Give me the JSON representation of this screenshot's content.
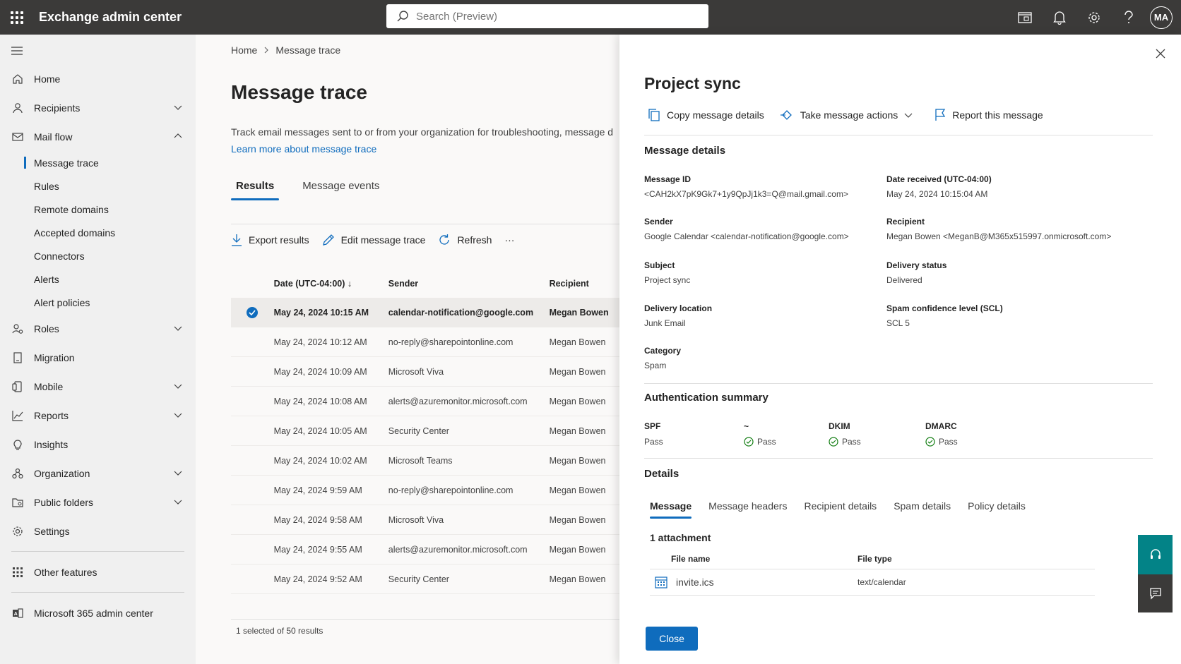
{
  "app": {
    "title": "Exchange admin center"
  },
  "search": {
    "placeholder": "Search (Preview)"
  },
  "user": {
    "initials": "MA"
  },
  "sidebar": {
    "items": [
      {
        "label": "Home",
        "icon": "home-icon"
      },
      {
        "label": "Recipients",
        "icon": "person-icon"
      },
      {
        "label": "Mail flow",
        "icon": "mail-icon"
      },
      {
        "label": "Roles",
        "icon": "roles-icon"
      },
      {
        "label": "Migration",
        "icon": "migration-icon"
      },
      {
        "label": "Mobile",
        "icon": "mobile-icon"
      },
      {
        "label": "Reports",
        "icon": "chart-icon"
      },
      {
        "label": "Insights",
        "icon": "lightbulb-icon"
      },
      {
        "label": "Organization",
        "icon": "organization-icon"
      },
      {
        "label": "Public folders",
        "icon": "folder-icon"
      },
      {
        "label": "Settings",
        "icon": "gear-icon"
      },
      {
        "label": "Other features",
        "icon": "grid-icon"
      },
      {
        "label": "Microsoft 365 admin center",
        "icon": "office-icon"
      }
    ],
    "mailflow_sub": [
      "Message trace",
      "Rules",
      "Remote domains",
      "Accepted domains",
      "Connectors",
      "Alerts",
      "Alert policies"
    ]
  },
  "main": {
    "breadcrumb": [
      "Home",
      "Message trace"
    ],
    "title": "Message trace",
    "description": "Track email messages sent to or from your organization for troubleshooting, message d",
    "learn_more": "Learn more about message trace",
    "tabs": [
      "Results",
      "Message events"
    ],
    "toolbar": {
      "export": "Export results",
      "edit": "Edit message trace",
      "refresh": "Refresh",
      "more": "···"
    },
    "columns": [
      "Date (UTC-04:00) ↓",
      "Sender",
      "Recipient"
    ],
    "rows": [
      {
        "date": "May 24, 2024 10:15 AM",
        "sender": "calendar-notification@google.com",
        "recipient": "Megan Bowen"
      },
      {
        "date": "May 24, 2024 10:12 AM",
        "sender": "no-reply@sharepointonline.com",
        "recipient": "Megan Bowen"
      },
      {
        "date": "May 24, 2024 10:09 AM",
        "sender": "Microsoft Viva",
        "recipient": "Megan Bowen"
      },
      {
        "date": "May 24, 2024 10:08 AM",
        "sender": "alerts@azuremonitor.microsoft.com",
        "recipient": "Megan Bowen"
      },
      {
        "date": "May 24, 2024 10:05 AM",
        "sender": "Security Center",
        "recipient": "Megan Bowen"
      },
      {
        "date": "May 24, 2024 10:02 AM",
        "sender": "Microsoft Teams",
        "recipient": "Megan Bowen"
      },
      {
        "date": "May 24, 2024 9:59 AM",
        "sender": "no-reply@sharepointonline.com",
        "recipient": "Megan Bowen"
      },
      {
        "date": "May 24, 2024 9:58 AM",
        "sender": "Microsoft Viva",
        "recipient": "Megan Bowen"
      },
      {
        "date": "May 24, 2024 9:55 AM",
        "sender": "alerts@azuremonitor.microsoft.com",
        "recipient": "Megan Bowen"
      },
      {
        "date": "May 24, 2024 9:52 AM",
        "sender": "Security Center",
        "recipient": "Megan Bowen"
      }
    ],
    "footer": "1 selected of 50 results"
  },
  "panel": {
    "title": "Project sync",
    "actions": {
      "copy": "Copy message details",
      "take": "Take message actions",
      "report": "Report this message"
    },
    "message_details_heading": "Message details",
    "fields": {
      "message_id": {
        "label": "Message ID",
        "value": "<CAH2kX7pK9Gk7+1y9QpJj1k3=Q@mail.gmail.com>"
      },
      "date_received": {
        "label": "Date received (UTC-04:00)",
        "value": "May 24, 2024 10:15:04 AM"
      },
      "sender": {
        "label": "Sender",
        "value": "Google Calendar <calendar-notification@google.com>"
      },
      "recipient": {
        "label": "Recipient",
        "value": "Megan Bowen <MeganB@M365x515997.onmicrosoft.com>"
      },
      "subject": {
        "label": "Subject",
        "value": "Project sync"
      },
      "delivery_status": {
        "label": "Delivery status",
        "value": "Delivered"
      },
      "delivery_location": {
        "label": "Delivery location",
        "value": "Junk Email"
      },
      "scl": {
        "label": "Spam confidence level (SCL)",
        "value": "SCL 5"
      },
      "category": {
        "label": "Category",
        "value": "Spam"
      }
    },
    "auth_heading": "Authentication summary",
    "auth": [
      {
        "label": "SPF",
        "value": "Pass",
        "icon": false
      },
      {
        "label": "~",
        "value": "Pass",
        "icon": true
      },
      {
        "label": "DKIM",
        "value": "Pass",
        "icon": true
      },
      {
        "label": "DMARC",
        "value": "Pass",
        "icon": true
      }
    ],
    "details_heading": "Details",
    "detail_tabs": [
      "Message",
      "Message headers",
      "Recipient details",
      "Spam details",
      "Policy details"
    ],
    "attachments_heading": "1 attachment",
    "attachment_columns": [
      "File name",
      "File type"
    ],
    "attachments": [
      {
        "name": "invite.ics",
        "type": "text/calendar"
      }
    ],
    "close_label": "Close"
  },
  "colors": {
    "topbar": "#3b3a39",
    "accent": "#0f6cbd",
    "help": "#038387"
  }
}
